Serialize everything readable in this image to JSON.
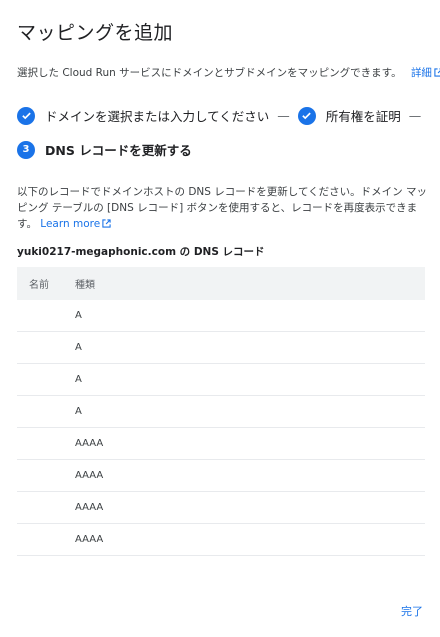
{
  "dialog": {
    "title": "マッピングを追加",
    "description": "選択した Cloud Run サービスにドメインとサブドメインをマッピングできます。",
    "details_link": "詳細"
  },
  "steps": [
    {
      "label": "ドメインを選択または入力してください",
      "state": "done"
    },
    {
      "label": "所有権を証明",
      "state": "done"
    },
    {
      "number": "3",
      "label": "DNS レコードを更新する",
      "state": "active"
    }
  ],
  "separator": "—",
  "instructions": {
    "text": "以下のレコードでドメインホストの DNS レコードを更新してください。ドメイン マッピング テーブルの [DNS レコード] ボタンを使用すると、レコードを再度表示できます。",
    "learn_more": "Learn more"
  },
  "records": {
    "heading": "yuki0217-megaphonic.com の DNS レコード",
    "columns": {
      "name": "名前",
      "type": "種類"
    },
    "rows": [
      {
        "name": "",
        "type": "A"
      },
      {
        "name": "",
        "type": "A"
      },
      {
        "name": "",
        "type": "A"
      },
      {
        "name": "",
        "type": "A"
      },
      {
        "name": "",
        "type": "AAAA"
      },
      {
        "name": "",
        "type": "AAAA"
      },
      {
        "name": "",
        "type": "AAAA"
      },
      {
        "name": "",
        "type": "AAAA"
      }
    ]
  },
  "footer": {
    "done_label": "完了"
  },
  "colors": {
    "accent": "#1a73e8",
    "header_bg": "#f1f3f4",
    "divider": "#e8eaed"
  }
}
